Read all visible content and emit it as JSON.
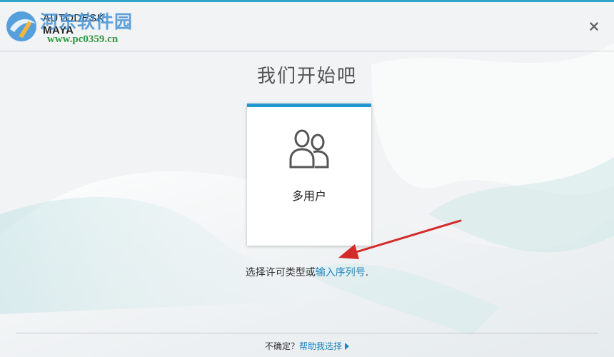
{
  "header": {
    "brand_line1": "AUTODESK",
    "brand_line2": "MAYA",
    "watermark_text": "河东软件园",
    "watermark_url": "www.pc0359.cn",
    "close_icon": "close-icon",
    "close_label": "×"
  },
  "main": {
    "title": "我们开始吧",
    "card": {
      "icon": "users-icon",
      "label": "多用户"
    },
    "hint_prefix": "选择许可类型或",
    "hint_link": "输入序列号",
    "hint_suffix": "."
  },
  "footer": {
    "prefix": "不确定？",
    "link": "帮助我选择"
  },
  "colors": {
    "accent": "#2596cf",
    "link": "#1f86bf",
    "arrow": "#d42a2a",
    "watermark": "#3d8fd6",
    "watermark_url": "#2f9a3e"
  }
}
